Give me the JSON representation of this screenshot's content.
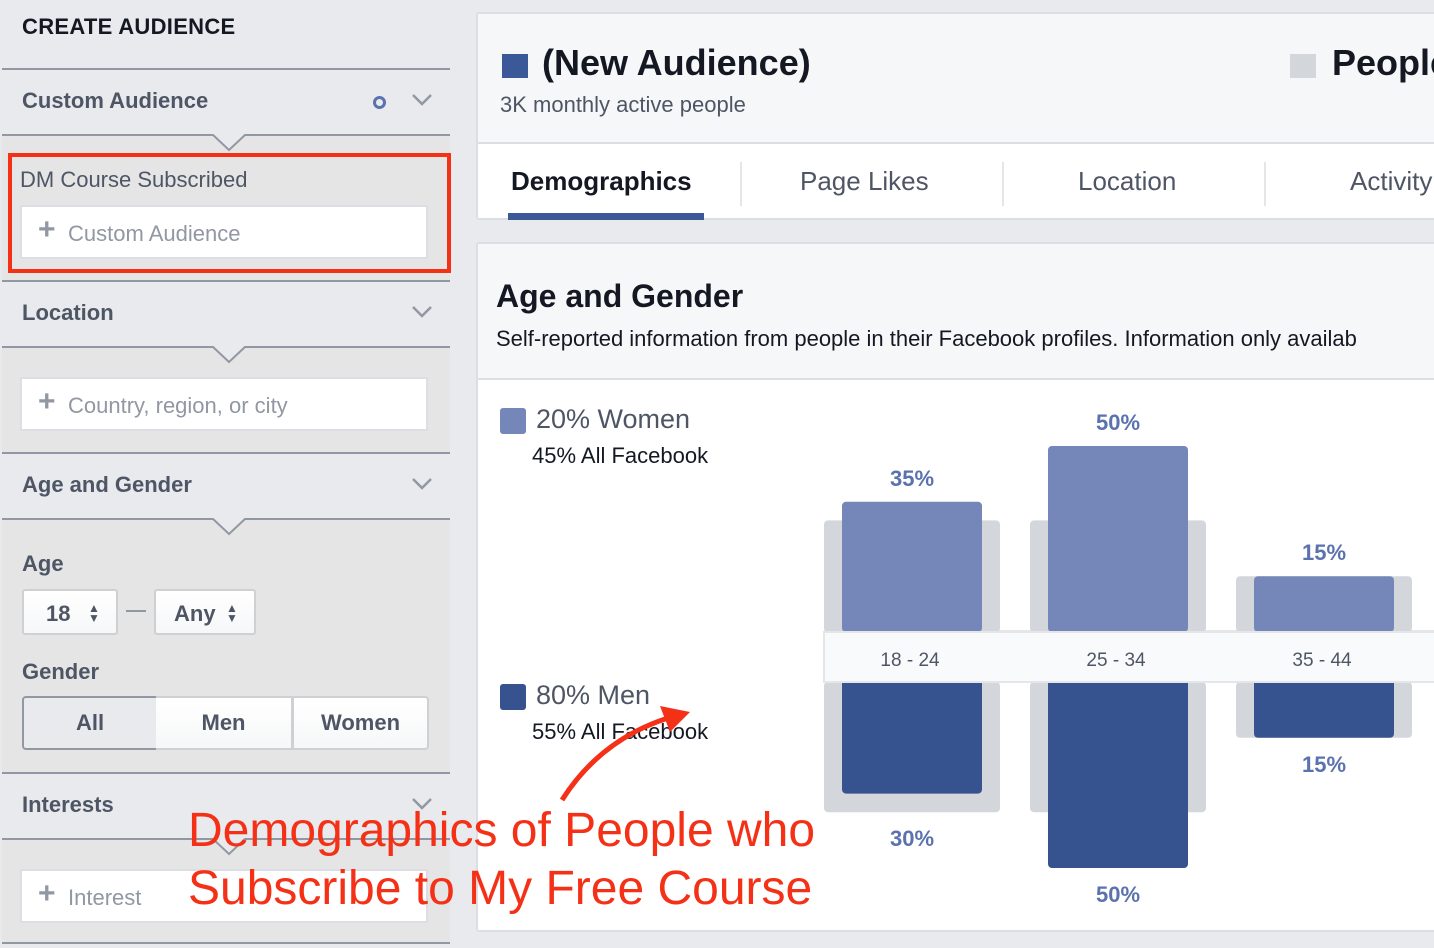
{
  "sidebar": {
    "title": "CREATE AUDIENCE",
    "custom_audience": {
      "label": "Custom Audience",
      "selected": "DM Course Subscribed",
      "placeholder": "Custom Audience"
    },
    "location": {
      "label": "Location",
      "placeholder": "Country, region, or city"
    },
    "age_gender": {
      "label": "Age and Gender",
      "age_label": "Age",
      "age_min": "18",
      "age_max": "Any",
      "gender_label": "Gender",
      "gender_options": [
        "All",
        "Men",
        "Women"
      ],
      "gender_selected": "All"
    },
    "interests": {
      "label": "Interests",
      "placeholder": "Interest"
    }
  },
  "header": {
    "audience_name": "(New Audience)",
    "audience_size": "3K monthly active people",
    "compare_name": "People",
    "tabs": [
      "Demographics",
      "Page Likes",
      "Location",
      "Activity"
    ],
    "active_tab": "Demographics"
  },
  "colors": {
    "women": "#7587b8",
    "men": "#37538f",
    "all_facebook": "#d3d6db",
    "label": "#5b72ae",
    "annotation": "#f43117"
  },
  "chart_data": {
    "type": "bar",
    "title": "Age and Gender",
    "subtitle": "Self-reported information from people in their Facebook profiles. Information only availab",
    "categories": [
      "18 - 24",
      "25 - 34",
      "35 - 44"
    ],
    "series": [
      {
        "name": "Women",
        "summary": "20% Women",
        "comparison": "45% All Facebook",
        "values": [
          35,
          50,
          15
        ],
        "labels": [
          "35%",
          "50%",
          "15%"
        ],
        "direction": "up"
      },
      {
        "name": "Men",
        "summary": "80% Men",
        "comparison": "55% All Facebook",
        "values": [
          30,
          50,
          15
        ],
        "labels": [
          "30%",
          "50%",
          "15%"
        ],
        "direction": "down"
      }
    ],
    "all_facebook": {
      "women": [
        30,
        30,
        15
      ],
      "men": [
        35,
        35,
        15
      ]
    },
    "ylim": [
      0,
      50
    ]
  },
  "annotation": {
    "line1": "Demographics of People who",
    "line2": "Subscribe to My Free Course"
  }
}
